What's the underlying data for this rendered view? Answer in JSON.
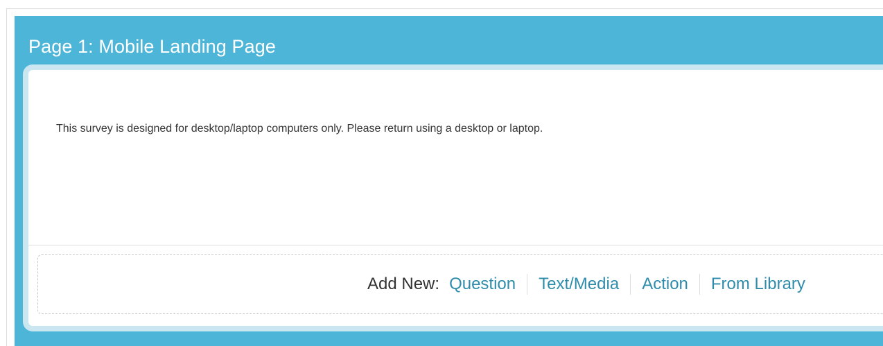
{
  "page": {
    "title": "Page 1: Mobile Landing Page",
    "message": "This survey is designed for desktop/laptop computers only. Please return using a desktop or laptop."
  },
  "add_new": {
    "label": "Add New:",
    "links": [
      "Question",
      "Text/Media",
      "Action",
      "From Library"
    ]
  },
  "colors": {
    "header": "#4db5d8",
    "card_border": "#c9e6f1",
    "link": "#2f8cac",
    "text": "#333333"
  }
}
